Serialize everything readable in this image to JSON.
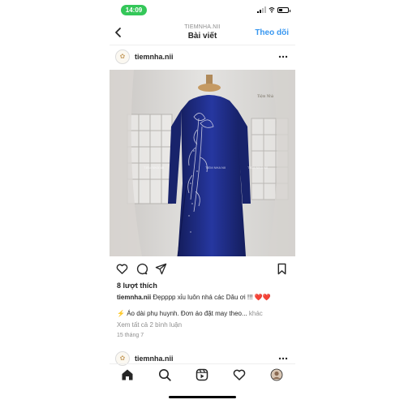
{
  "status_bar": {
    "time": "14:09",
    "battery_level": 0.4
  },
  "header": {
    "username": "TIEMNHA.NII",
    "title": "Bài viết",
    "follow_label": "Theo dõi"
  },
  "post": {
    "username": "tiemnha.nii",
    "avatar_mark": "✿",
    "photo_watermarks": [
      "Tiệm Nhà",
      "TIEM NHA NII",
      "TIEM NHA NII",
      "TIEM NHA NII"
    ],
    "likes": "8 lượt thích",
    "caption_username": "tiemnha.nii",
    "caption_text": "Đẹpppp xỉu luôn nhá các Dâu ơi !!!",
    "caption_emoji": "❤️❤️",
    "description_emoji": "⚡",
    "description": "Áo dài phụ huynh. Đơn áo đặt may theo...",
    "description_more": "khác",
    "view_comments": "Xem tất cả 2 bình luận",
    "date": "15 tháng 7"
  },
  "next_post": {
    "username": "tiemnha.nii",
    "avatar_mark": "✿"
  },
  "icons": {
    "back": "chevron-left-icon",
    "more": "more-horizontal-icon",
    "like": "heart-icon",
    "comment": "comment-icon",
    "share": "send-icon",
    "save": "bookmark-icon",
    "home": "home-icon",
    "search": "search-icon",
    "reels": "reels-icon",
    "activity": "heart-icon",
    "profile": "profile-avatar-icon"
  },
  "colors": {
    "accent": "#3897f0",
    "status_pill": "#34c759",
    "heart": "#e0245e",
    "dress": "#1c2a7a"
  }
}
